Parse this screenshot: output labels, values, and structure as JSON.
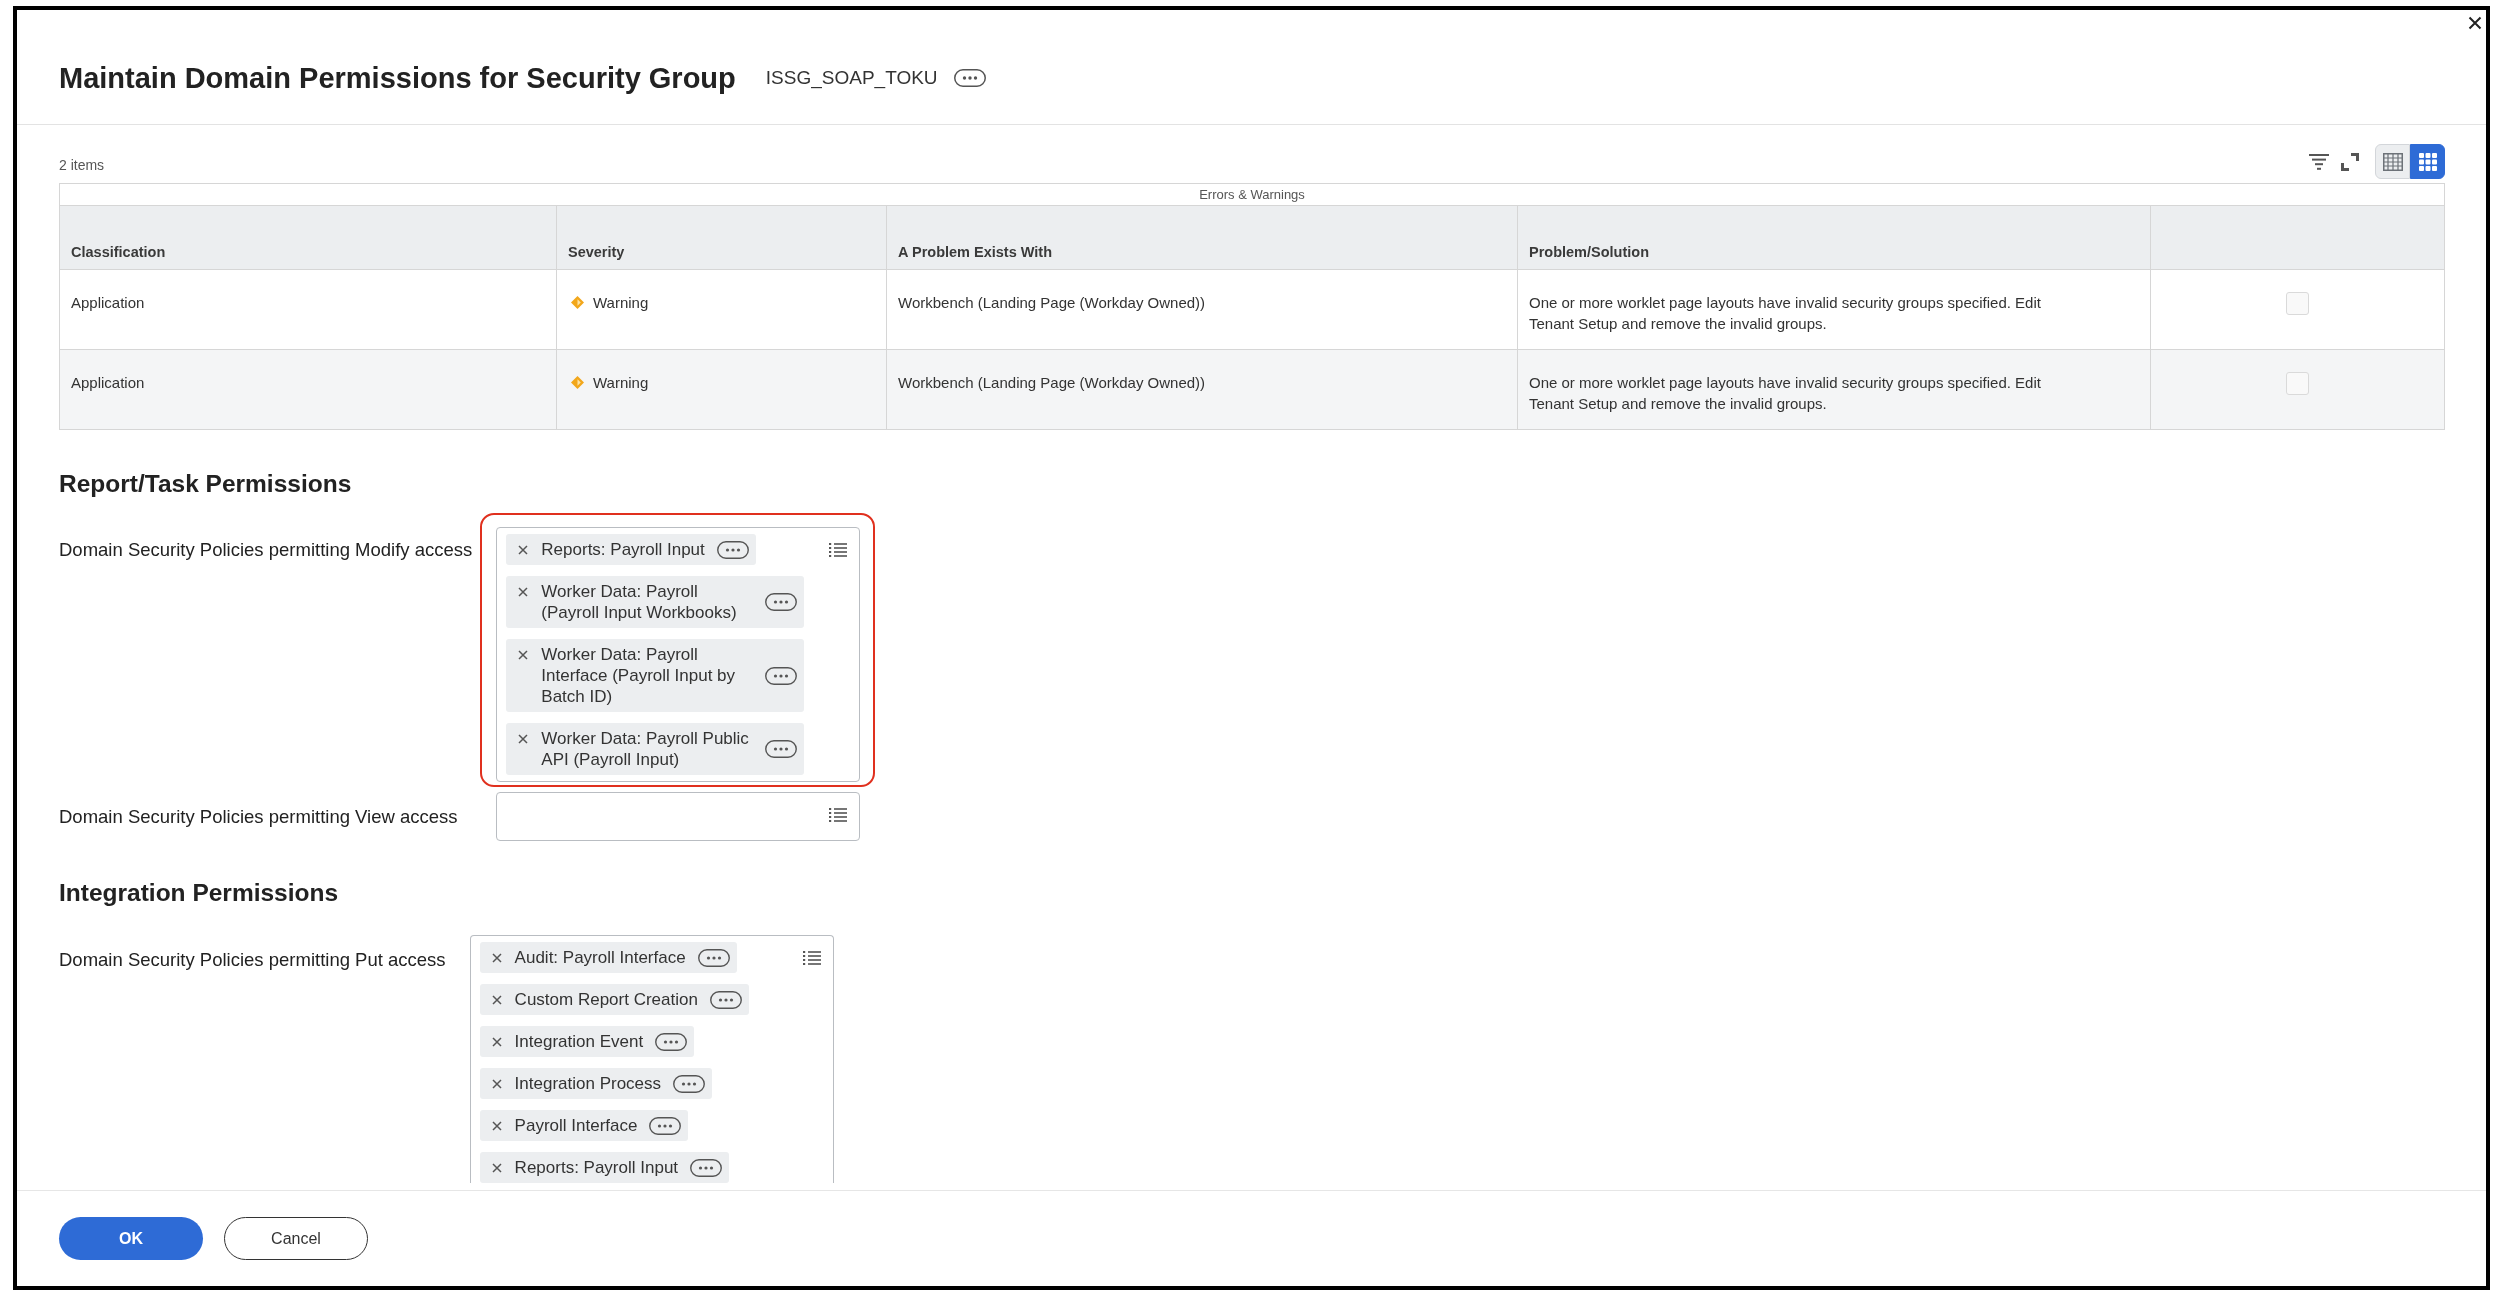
{
  "dialog": {
    "title": "Maintain Domain Permissions for Security Group",
    "subject": "ISSG_SOAP_TOKU"
  },
  "table": {
    "item_count": "2 items",
    "view_toggle": [
      {
        "kind": "table",
        "selected": false
      },
      {
        "kind": "tiles",
        "selected": true
      }
    ],
    "caption": "Errors & Warnings",
    "columns": [
      "Classification",
      "Severity",
      "A Problem Exists With",
      "Problem/Solution"
    ],
    "rows": [
      {
        "classification": "Application",
        "severity": {
          "text": "Warning",
          "kind": "warning"
        },
        "problem_with": "Workbench (Landing Page (Workday Owned))",
        "solution": "One or more worklet page layouts have invalid security groups specified. Edit Tenant Setup and remove the invalid groups.",
        "checked": false
      },
      {
        "classification": "Application",
        "severity": {
          "text": "Warning",
          "kind": "warning"
        },
        "problem_with": "Workbench (Landing Page (Workday Owned))",
        "solution": "One or more worklet page layouts have invalid security groups specified. Edit Tenant Setup and remove the invalid groups.",
        "checked": false
      }
    ]
  },
  "sections": [
    {
      "heading": "Report/Task Permissions",
      "fields": [
        {
          "label": "Domain Security Policies permitting Modify access",
          "highlighted": true,
          "values": [
            "Reports: Payroll Input",
            "Worker Data: Payroll (Payroll Input Workbooks)",
            "Worker Data: Payroll Interface (Payroll Input by Batch ID)",
            "Worker Data: Payroll Public API (Payroll Input)"
          ]
        },
        {
          "label": "Domain Security Policies permitting View access",
          "highlighted": false
        }
      ]
    },
    {
      "heading": "Integration Permissions",
      "fields": [
        {
          "label": "Domain Security Policies permitting Put access",
          "highlighted": false,
          "values": [
            "Audit: Payroll Interface",
            "Custom Report Creation",
            "Integration Event",
            "Integration Process",
            "Payroll Interface",
            "Reports: Payroll Input"
          ]
        }
      ]
    }
  ],
  "buttons": [
    {
      "label": "OK",
      "kind": "primary"
    },
    {
      "label": "Cancel",
      "kind": "secondary"
    }
  ]
}
